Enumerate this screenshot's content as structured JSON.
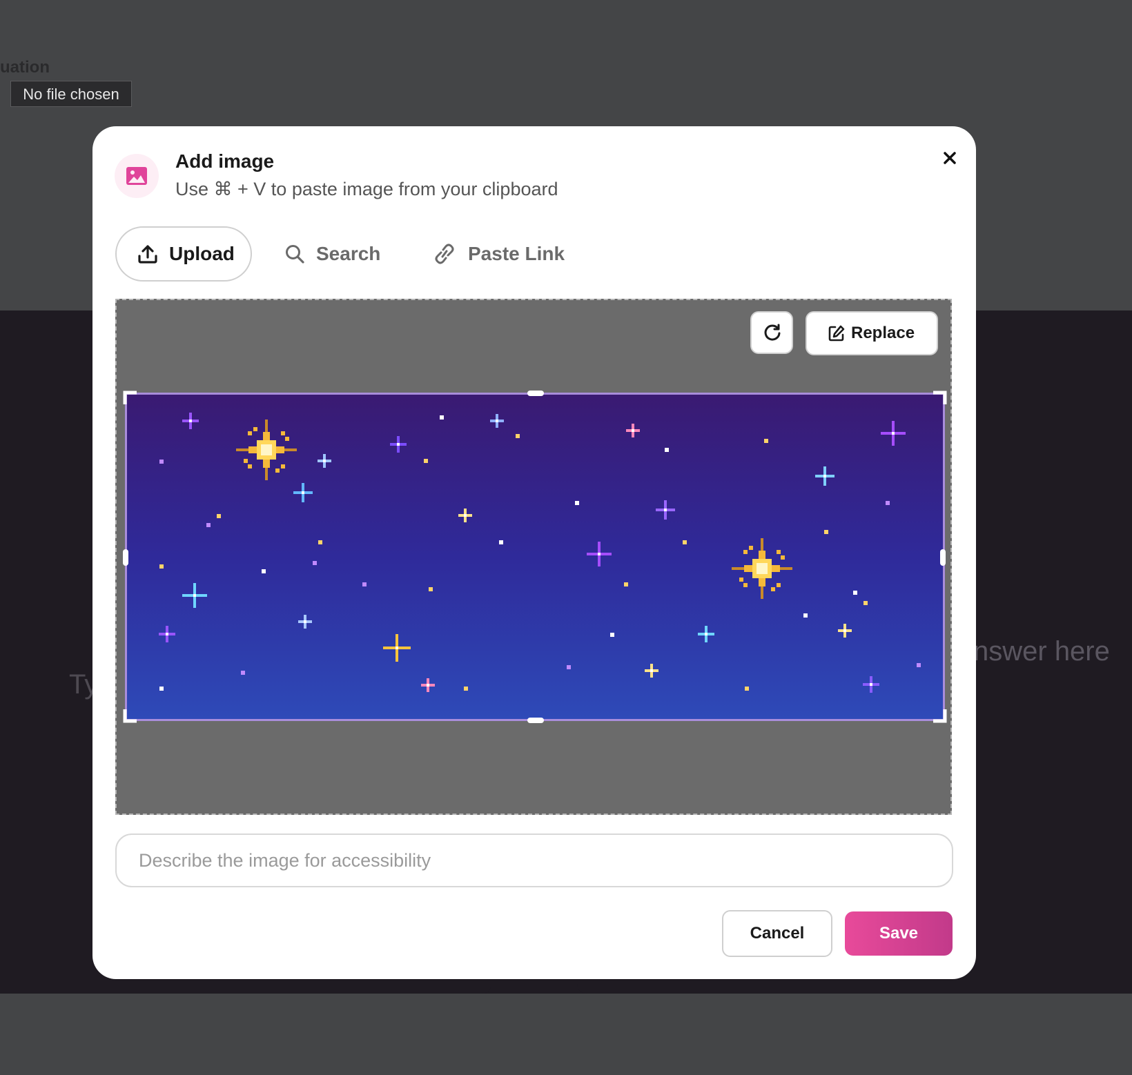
{
  "background": {
    "section_label": "uation",
    "file_input_status": "No file chosen",
    "ghost_left_text": "Ty",
    "ghost_right_text": "nswer here"
  },
  "modal": {
    "title": "Add image",
    "subtitle": "Use ⌘ + V to paste image from your clipboard",
    "tabs": [
      {
        "label": "Upload",
        "icon": "upload-icon",
        "active": true
      },
      {
        "label": "Search",
        "icon": "search-icon",
        "active": false
      },
      {
        "label": "Paste Link",
        "icon": "link-icon",
        "active": false
      }
    ],
    "preview": {
      "replace_label": "Replace"
    },
    "alt_placeholder": "Describe the image for accessibility",
    "cancel_label": "Cancel",
    "save_label": "Save"
  },
  "colors": {
    "accent": "#e0449a",
    "crop_border": "#a98ddb",
    "sky_top": "#3a1a72",
    "sky_bottom": "#2e4ab8"
  }
}
